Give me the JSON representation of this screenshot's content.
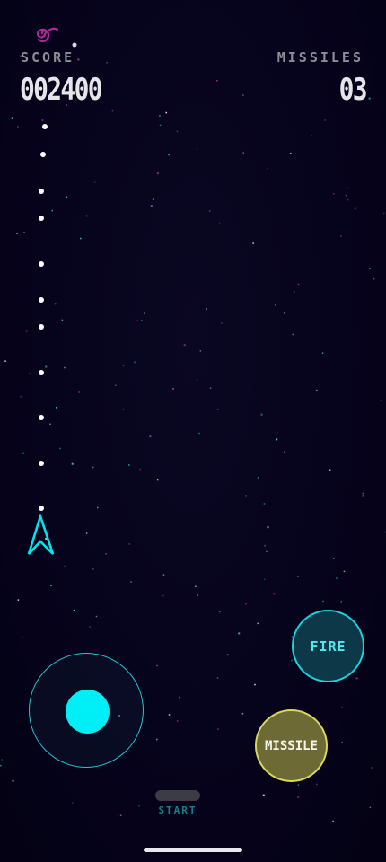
{
  "hud": {
    "score_label": "SCORE",
    "score_value": "002400",
    "missiles_label": "MISSILES",
    "missiles_value": "03"
  },
  "controls": {
    "fire_label": "FIRE",
    "missile_label": "MISSILE",
    "start_label": "START"
  },
  "icons": {
    "top_left": "spiral-icon",
    "player": "ship-arrow-icon"
  },
  "colors": {
    "background": "#06031a",
    "accent_cyan": "#00eef5",
    "fire_fill": "#0c3848",
    "missile_fill": "#6e6a35",
    "missile_border": "#d8d85a",
    "spiral_magenta": "#b3269b",
    "hud_label": "#8d8d95"
  }
}
